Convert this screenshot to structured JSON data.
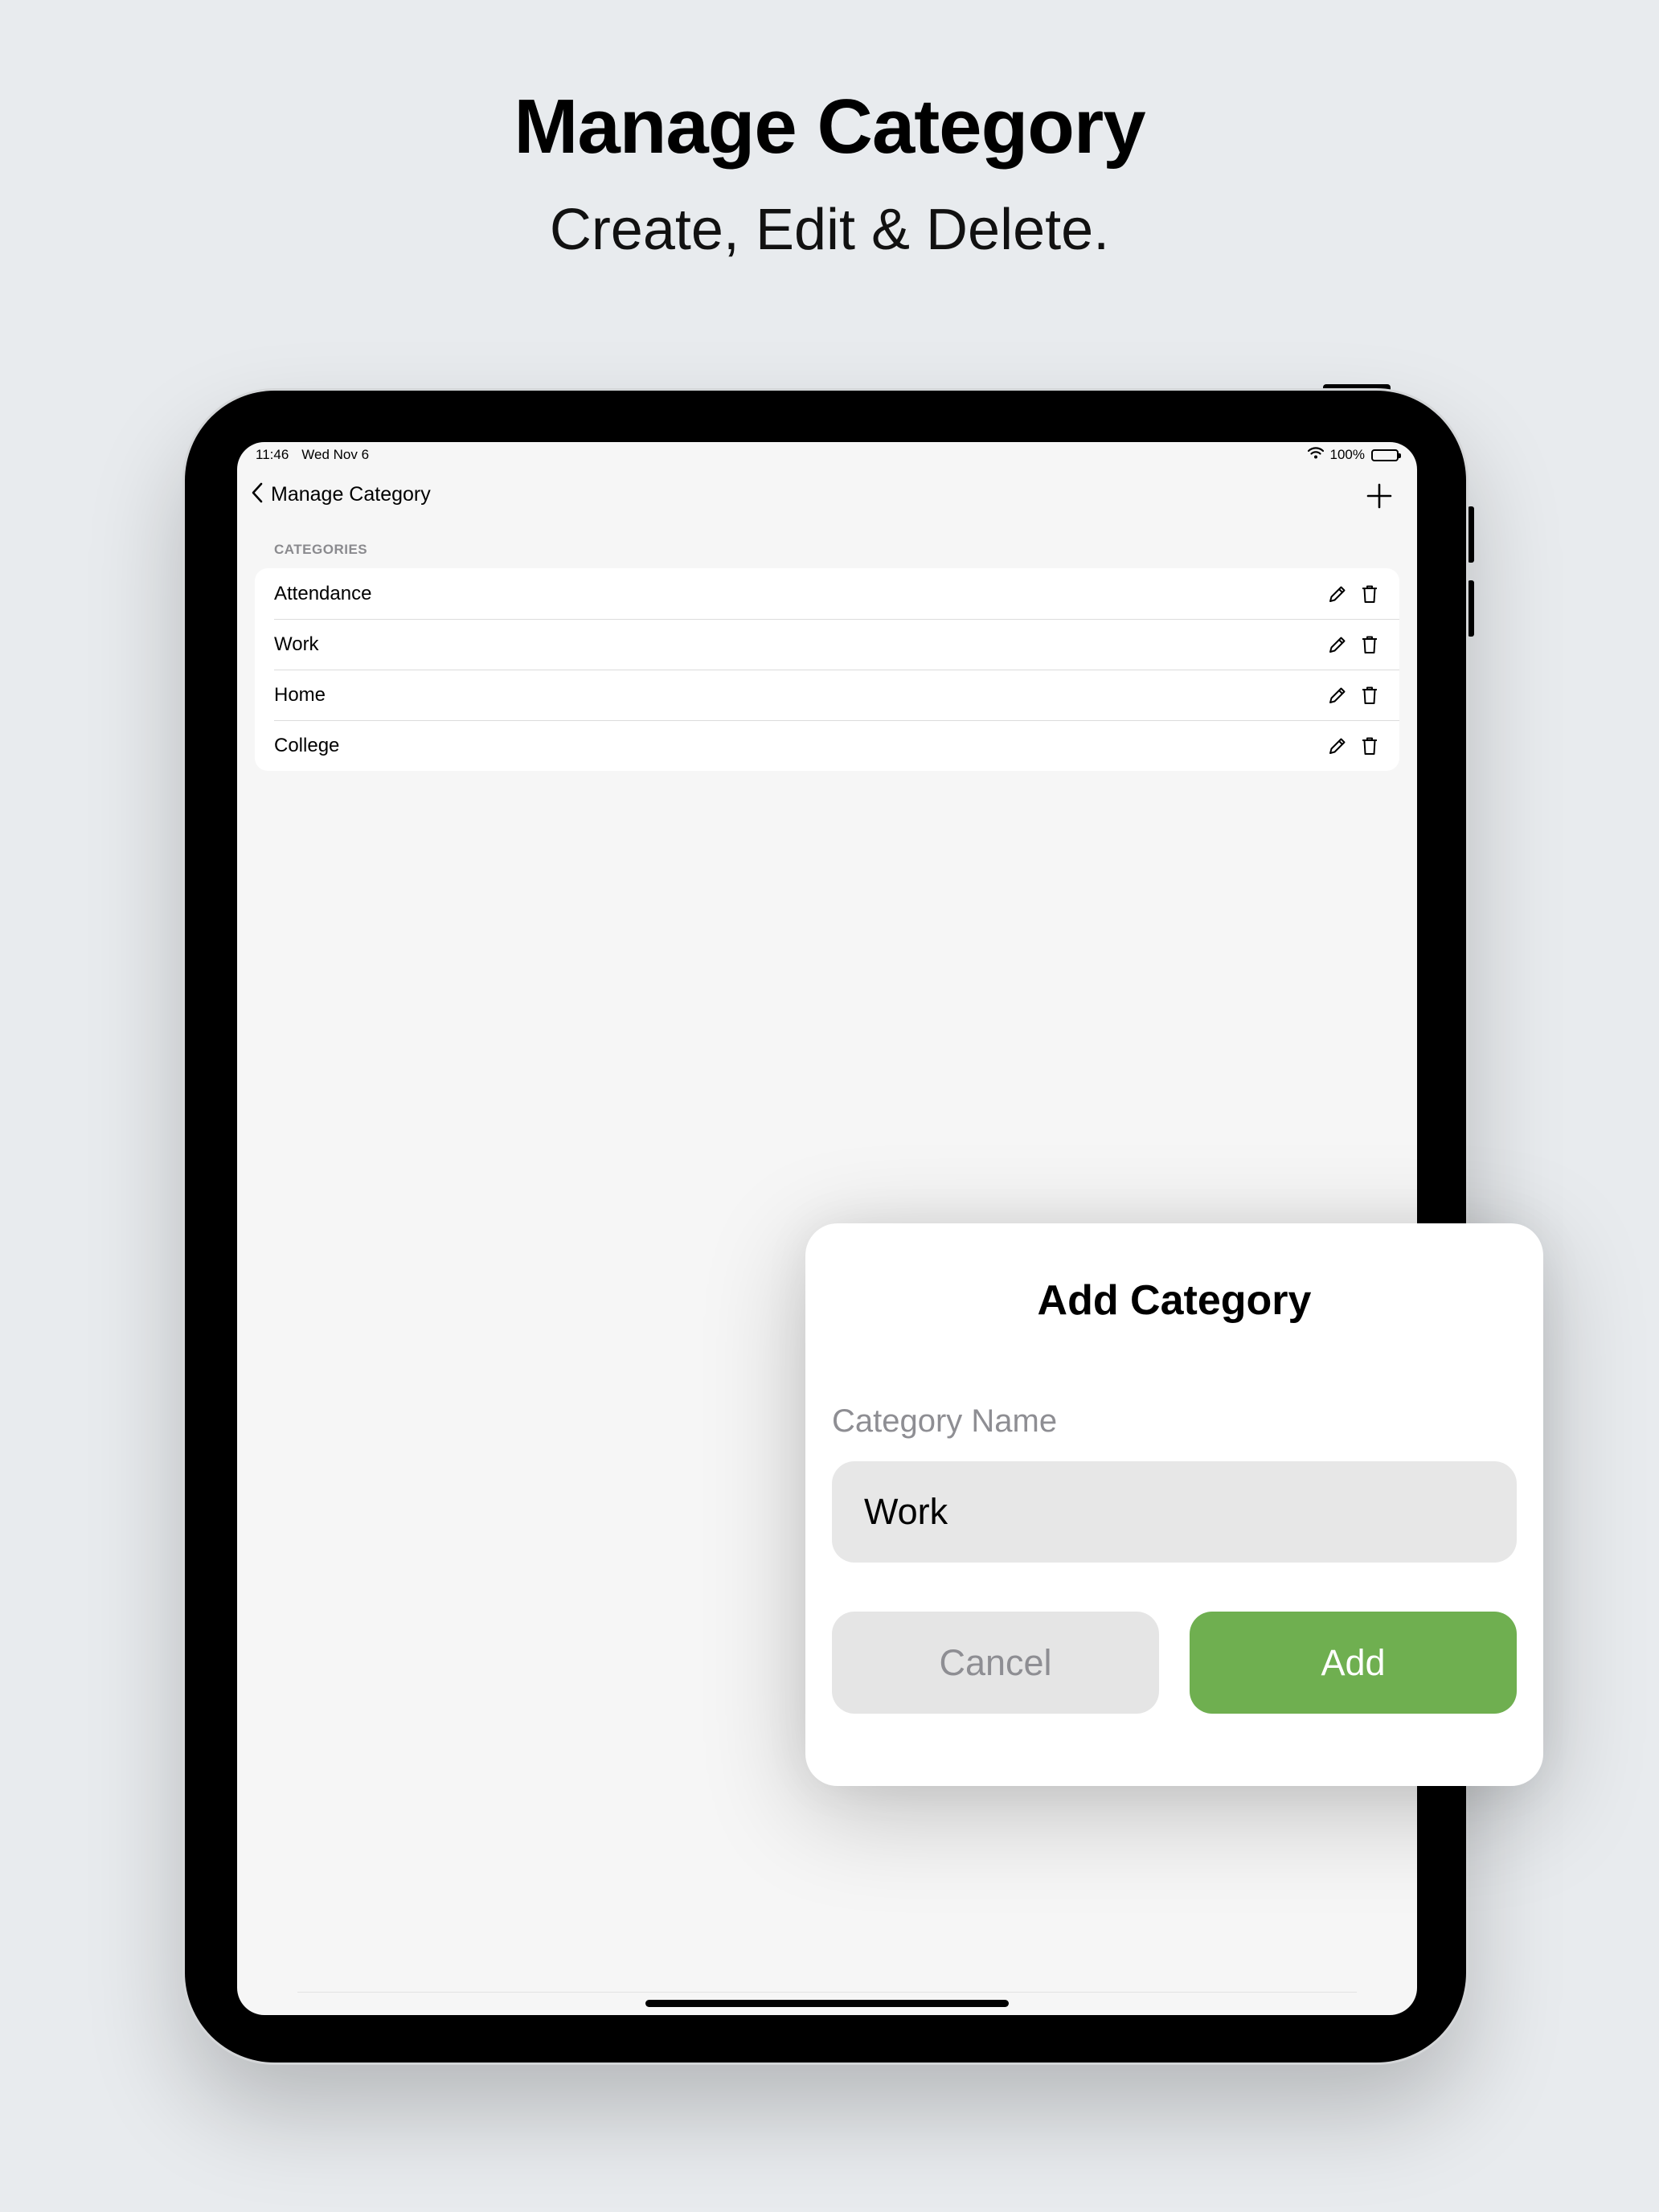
{
  "promo": {
    "headline": "Manage Category",
    "subheadline": "Create, Edit & Delete."
  },
  "status_bar": {
    "time": "11:46",
    "date": "Wed Nov 6",
    "battery": "100%"
  },
  "nav": {
    "title": "Manage Category",
    "back_icon": "chevron-left-icon",
    "add_icon": "plus-icon"
  },
  "section_header": "CATEGORIES",
  "categories": [
    {
      "label": "Attendance"
    },
    {
      "label": "Work"
    },
    {
      "label": "Home"
    },
    {
      "label": "College"
    }
  ],
  "row_icons": [
    "pencil-icon",
    "trash-icon"
  ],
  "modal": {
    "title": "Add Category",
    "field_label": "Category Name",
    "field_value": "Work",
    "cancel_label": "Cancel",
    "add_label": "Add"
  },
  "colors": {
    "add_button": "#6faf50",
    "background": "#e8ebee",
    "screen": "#f6f6f6"
  }
}
